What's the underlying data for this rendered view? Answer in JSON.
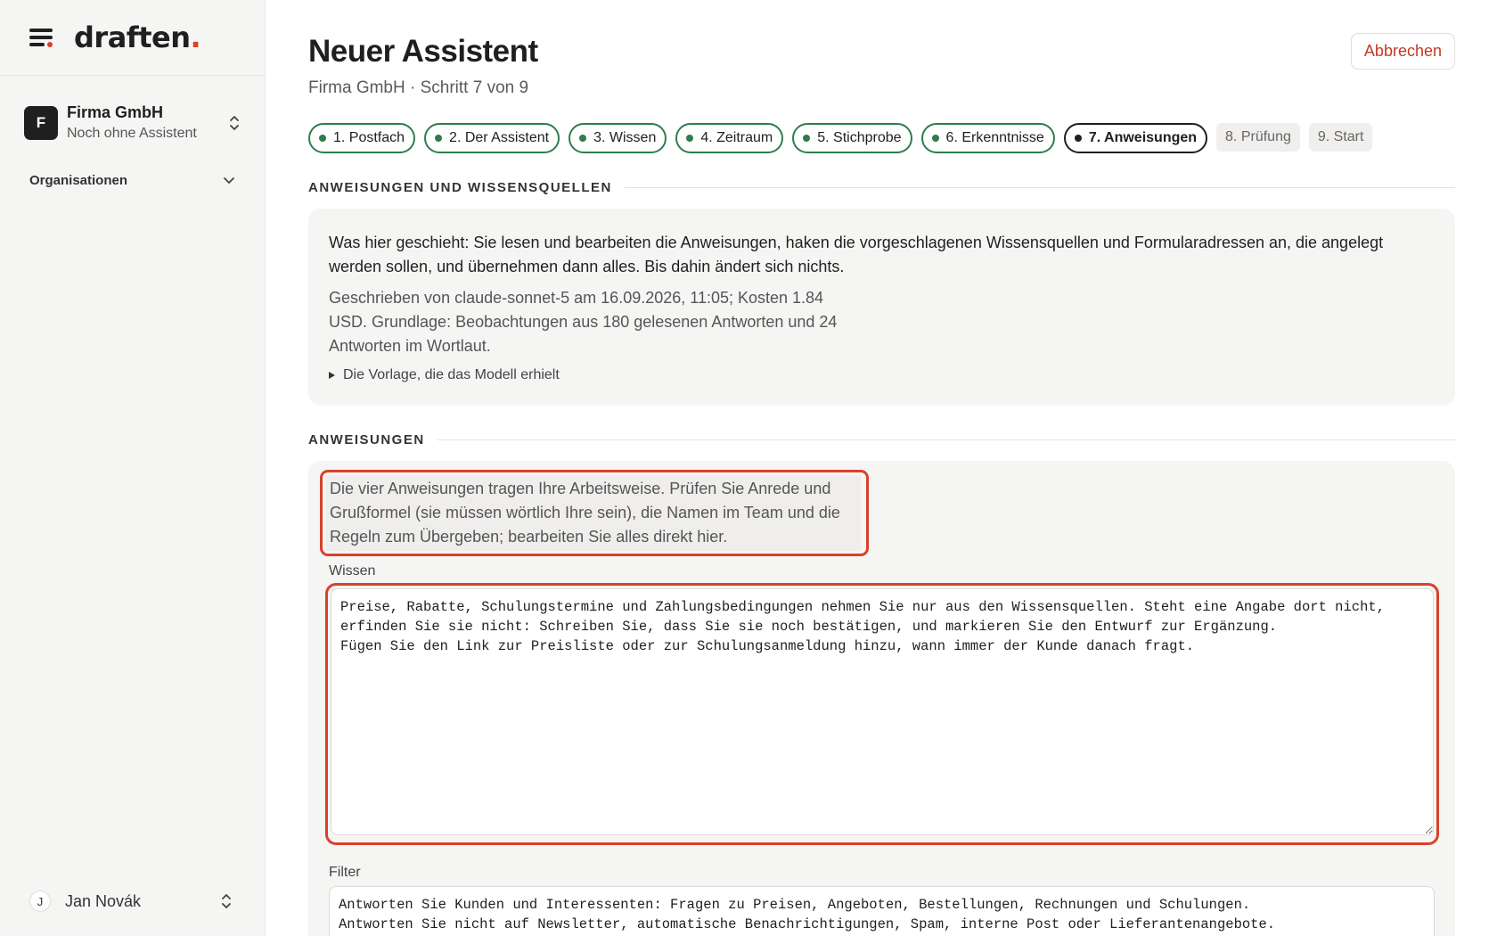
{
  "app": {
    "logo_text": "draften",
    "logo_dot": "."
  },
  "sidebar": {
    "org": {
      "avatar_letter": "F",
      "name": "Firma GmbH",
      "subtitle": "Noch ohne Assistent"
    },
    "nav_group": "Organisationen",
    "user": {
      "avatar_letter": "J",
      "name": "Jan Novák"
    }
  },
  "header": {
    "title": "Neuer Assistent",
    "subtitle": "Firma GmbH · Schritt 7 von 9",
    "cancel_label": "Abbrechen"
  },
  "steps": [
    {
      "label": "1. Postfach",
      "state": "done"
    },
    {
      "label": "2. Der Assistent",
      "state": "done"
    },
    {
      "label": "3. Wissen",
      "state": "done"
    },
    {
      "label": "4. Zeitraum",
      "state": "done"
    },
    {
      "label": "5. Stichprobe",
      "state": "done"
    },
    {
      "label": "6. Erkenntnisse",
      "state": "done"
    },
    {
      "label": "7. Anweisungen",
      "state": "current"
    },
    {
      "label": "8. Prüfung",
      "state": "pending"
    },
    {
      "label": "9. Start",
      "state": "pending"
    }
  ],
  "section1": {
    "heading": "ANWEISUNGEN UND WISSENSQUELLEN",
    "lead": "Was hier geschieht: Sie lesen und bearbeiten die Anweisungen, haken die vorgeschlagenen Wissensquellen und Formularadressen an, die angelegt werden sollen, und übernehmen dann alles. Bis dahin ändert sich nichts.",
    "meta": "Geschrieben von claude-sonnet-5 am 16.09.2026, 11:05; Kosten 1.84 USD. Grundlage: Beobachtungen aus 180 gelesenen Antworten und 24 Antworten im Wortlaut.",
    "toggle": "Die Vorlage, die das Modell erhielt"
  },
  "section2": {
    "heading": "ANWEISUNGEN",
    "hint": "Die vier Anweisungen tragen Ihre Arbeitsweise. Prüfen Sie Anrede und Grußformel (sie müssen wörtlich Ihre sein), die Namen im Team und die Regeln zum Übergeben; bearbeiten Sie alles direkt hier.",
    "knowledge_label": "Wissen",
    "knowledge_value": "Preise, Rabatte, Schulungstermine und Zahlungsbedingungen nehmen Sie nur aus den Wissensquellen. Steht eine Angabe dort nicht,\nerfinden Sie sie nicht: Schreiben Sie, dass Sie sie noch bestätigen, und markieren Sie den Entwurf zur Ergänzung.\nFügen Sie den Link zur Preisliste oder zur Schulungsanmeldung hinzu, wann immer der Kunde danach fragt.",
    "filter_label": "Filter",
    "filter_value": "Antworten Sie Kunden und Interessenten: Fragen zu Preisen, Angeboten, Bestellungen, Rechnungen und Schulungen.\nAntworten Sie nicht auf Newsletter, automatische Benachrichtigungen, Spam, interne Post oder Lieferantenangebote.\nLassen Sie Post ohne Frage (Dank, Bestätigungen) unbeantwortet."
  },
  "colors": {
    "accent": "#d9412a",
    "done": "#2e7d4f",
    "sidebar_bg": "#f5f5f4"
  }
}
